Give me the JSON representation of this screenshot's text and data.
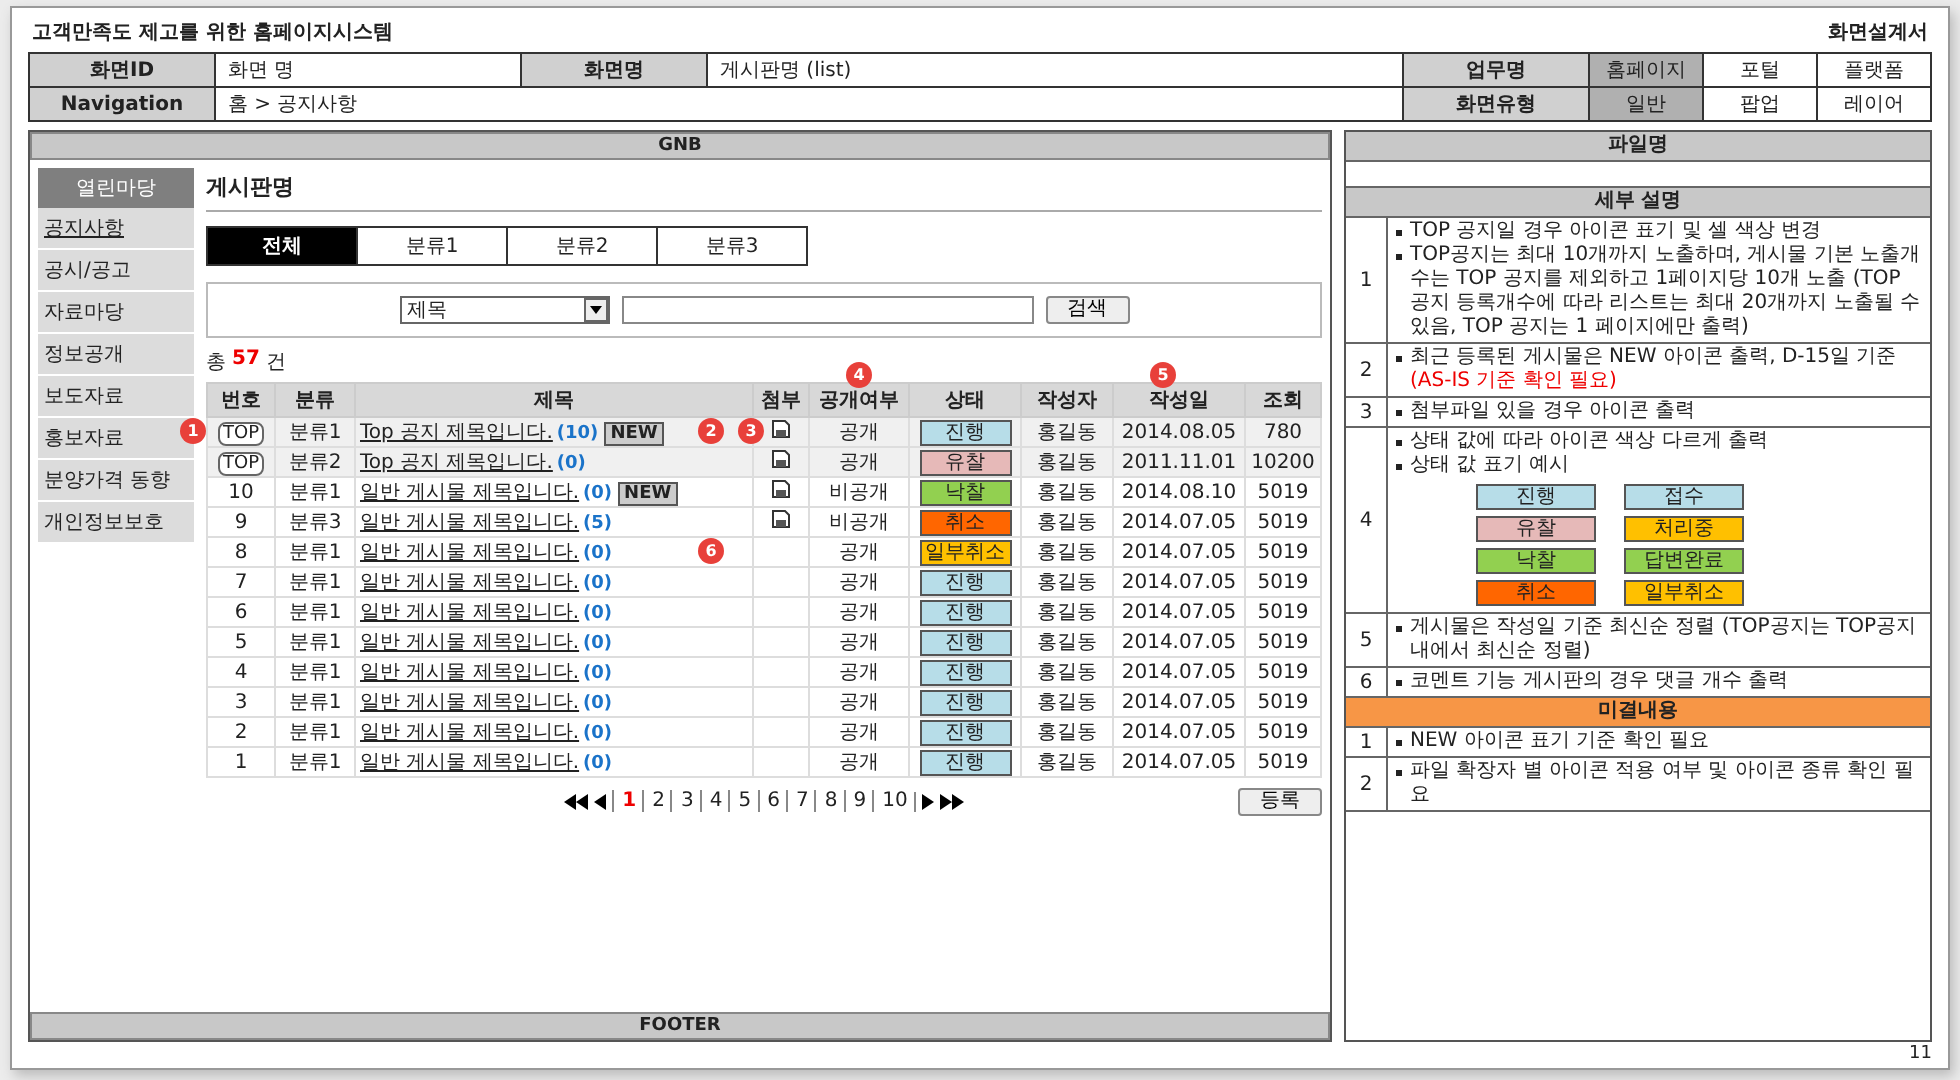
{
  "doc": {
    "project": "고객만족도 제고를 위한 홈페이지시스템",
    "doc_type": "화면설계서",
    "page_number": "11"
  },
  "info": {
    "id_label": "화면ID",
    "id_value": "화면 명",
    "name_label": "화면명",
    "name_value": "게시판명 (list)",
    "nav_label": "Navigation",
    "nav_value": "홈 > 공지사항",
    "work_label": "업무명",
    "type_label": "화면유형",
    "work_options": [
      {
        "label": "홈페이지",
        "selected": true
      },
      {
        "label": "포털",
        "selected": false
      },
      {
        "label": "플랫폼",
        "selected": false
      }
    ],
    "type_options": [
      {
        "label": "일반",
        "selected": true
      },
      {
        "label": "팝업",
        "selected": false
      },
      {
        "label": "레이어",
        "selected": false
      }
    ]
  },
  "gnb": "GNB",
  "footer": "FOOTER",
  "sidebar": {
    "title": "열린마당",
    "items": [
      {
        "label": "공지사항",
        "selected": true
      },
      {
        "label": "공시/공고",
        "selected": false
      },
      {
        "label": "자료마당",
        "selected": false
      },
      {
        "label": "정보공개",
        "selected": false
      },
      {
        "label": "보도자료",
        "selected": false
      },
      {
        "label": "홍보자료",
        "selected": false
      },
      {
        "label": "분양가격 동향",
        "selected": false
      },
      {
        "label": "개인정보보호",
        "selected": false
      }
    ]
  },
  "board": {
    "title": "게시판명",
    "tabs": [
      {
        "label": "전체",
        "selected": true
      },
      {
        "label": "분류1",
        "selected": false
      },
      {
        "label": "분류2",
        "selected": false
      },
      {
        "label": "분류3",
        "selected": false
      }
    ],
    "search": {
      "select_value": "제목",
      "button": "검색"
    },
    "count": {
      "prefix": "총",
      "value": "57",
      "suffix": "건"
    },
    "columns": [
      {
        "label": "번호"
      },
      {
        "label": "분류"
      },
      {
        "label": "제목"
      },
      {
        "label": "첨부"
      },
      {
        "label": "공개여부",
        "marker": "4"
      },
      {
        "label": "상태"
      },
      {
        "label": "작성자"
      },
      {
        "label": "작성일",
        "marker": "5"
      },
      {
        "label": "조회"
      }
    ],
    "rows": [
      {
        "kind": "top",
        "no": "TOP",
        "category": "분류1",
        "title": "Top 공지 제목입니다.",
        "comments": "(10)",
        "new_badge": "NEW",
        "attachment": true,
        "visibility": "공개",
        "status": {
          "label": "진행",
          "color": "#b7dde8"
        },
        "author": "홍길동",
        "date": "2014.08.05",
        "views": "780",
        "no_marker": "1",
        "title_marker": "2",
        "attach_marker": "3"
      },
      {
        "kind": "top",
        "no": "TOP",
        "category": "분류2",
        "title": "Top 공지 제목입니다.",
        "comments": "(0)",
        "attachment": true,
        "visibility": "공개",
        "status": {
          "label": "유찰",
          "color": "#e6b9b8"
        },
        "author": "홍길동",
        "date": "2011.11.01",
        "views": "10200"
      },
      {
        "kind": "normal",
        "no": "10",
        "category": "분류1",
        "title": "일반 게시물 제목입니다.",
        "comments": "(0)",
        "new_badge": "NEW",
        "attachment": true,
        "visibility": "비공개",
        "status": {
          "label": "낙찰",
          "color": "#92d050"
        },
        "author": "홍길동",
        "date": "2014.08.10",
        "views": "5019"
      },
      {
        "kind": "normal",
        "no": "9",
        "category": "분류3",
        "title": "일반 게시물 제목입니다.",
        "comments": "(5)",
        "attachment": true,
        "visibility": "비공개",
        "status": {
          "label": "취소",
          "color": "#ff6600"
        },
        "author": "홍길동",
        "date": "2014.07.05",
        "views": "5019"
      },
      {
        "kind": "normal",
        "no": "8",
        "category": "분류1",
        "title": "일반 게시물 제목입니다.",
        "comments": "(0)",
        "attachment": false,
        "visibility": "공개",
        "status": {
          "label": "일부취소",
          "color": "#ffc000"
        },
        "author": "홍길동",
        "date": "2014.07.05",
        "views": "5019",
        "title_marker": "6"
      },
      {
        "kind": "normal",
        "no": "7",
        "category": "분류1",
        "title": "일반 게시물 제목입니다.",
        "comments": "(0)",
        "attachment": false,
        "visibility": "공개",
        "status": {
          "label": "진행",
          "color": "#b7dde8"
        },
        "author": "홍길동",
        "date": "2014.07.05",
        "views": "5019"
      },
      {
        "kind": "normal",
        "no": "6",
        "category": "분류1",
        "title": "일반 게시물 제목입니다.",
        "comments": "(0)",
        "attachment": false,
        "visibility": "공개",
        "status": {
          "label": "진행",
          "color": "#b7dde8"
        },
        "author": "홍길동",
        "date": "2014.07.05",
        "views": "5019"
      },
      {
        "kind": "normal",
        "no": "5",
        "category": "분류1",
        "title": "일반 게시물 제목입니다.",
        "comments": "(0)",
        "attachment": false,
        "visibility": "공개",
        "status": {
          "label": "진행",
          "color": "#b7dde8"
        },
        "author": "홍길동",
        "date": "2014.07.05",
        "views": "5019"
      },
      {
        "kind": "normal",
        "no": "4",
        "category": "분류1",
        "title": "일반 게시물 제목입니다.",
        "comments": "(0)",
        "attachment": false,
        "visibility": "공개",
        "status": {
          "label": "진행",
          "color": "#b7dde8"
        },
        "author": "홍길동",
        "date": "2014.07.05",
        "views": "5019"
      },
      {
        "kind": "normal",
        "no": "3",
        "category": "분류1",
        "title": "일반 게시물 제목입니다.",
        "comments": "(0)",
        "attachment": false,
        "visibility": "공개",
        "status": {
          "label": "진행",
          "color": "#b7dde8"
        },
        "author": "홍길동",
        "date": "2014.07.05",
        "views": "5019"
      },
      {
        "kind": "normal",
        "no": "2",
        "category": "분류1",
        "title": "일반 게시물 제목입니다.",
        "comments": "(0)",
        "attachment": false,
        "visibility": "공개",
        "status": {
          "label": "진행",
          "color": "#b7dde8"
        },
        "author": "홍길동",
        "date": "2014.07.05",
        "views": "5019"
      },
      {
        "kind": "normal",
        "no": "1",
        "category": "분류1",
        "title": "일반 게시물 제목입니다.",
        "comments": "(0)",
        "attachment": false,
        "visibility": "공개",
        "status": {
          "label": "진행",
          "color": "#b7dde8"
        },
        "author": "홍길동",
        "date": "2014.07.05",
        "views": "5019"
      }
    ],
    "pagination": {
      "pages": [
        {
          "label": "1",
          "selected": true
        },
        {
          "label": "2",
          "selected": false
        },
        {
          "label": "3",
          "selected": false
        },
        {
          "label": "4",
          "selected": false
        },
        {
          "label": "5",
          "selected": false
        },
        {
          "label": "6",
          "selected": false
        },
        {
          "label": "7",
          "selected": false
        },
        {
          "label": "8",
          "selected": false
        },
        {
          "label": "9",
          "selected": false
        },
        {
          "label": "10",
          "selected": false
        }
      ]
    },
    "register_button": "등록"
  },
  "spec": {
    "file_header": "파일명",
    "detail_header": "세부 설명",
    "details": [
      {
        "no": "1",
        "bullets": [
          {
            "text": "TOP 공지일 경우 아이콘 표기 및 셀 색상 변경"
          },
          {
            "text": "TOP공지는 최대 10개까지 노출하며, 게시물 기본 노출개수는 TOP 공지를 제외하고 1페이지당 10개 노출 (TOP 공지 등록개수에 따라 리스트는 최대 20개까지 노출될 수 있음, TOP 공지는 1 페이지에만 출력)"
          }
        ]
      },
      {
        "no": "2",
        "bullets": [
          {
            "text": "최근 등록된 게시물은 NEW 아이콘 출력, D-15일 기준",
            "note": "(AS-IS 기준 확인 필요)"
          }
        ]
      },
      {
        "no": "3",
        "bullets": [
          {
            "text": "첨부파일 있을 경우 아이콘 출력"
          }
        ]
      },
      {
        "no": "4",
        "bullets": [
          {
            "text": "상태 값에 따라 아이콘 색상 다르게 출력"
          },
          {
            "text": "상태 값 표기 예시"
          }
        ],
        "badges": [
          {
            "label": "진행",
            "color": "#b7dde8"
          },
          {
            "label": "접수",
            "color": "#b7dde8"
          },
          {
            "label": "유찰",
            "color": "#e6b9b8"
          },
          {
            "label": "처리중",
            "color": "#ffc000"
          },
          {
            "label": "낙찰",
            "color": "#92d050"
          },
          {
            "label": "답변완료",
            "color": "#92d050"
          },
          {
            "label": "취소",
            "color": "#ff6600"
          },
          {
            "label": "일부취소",
            "color": "#ffc000"
          }
        ]
      },
      {
        "no": "5",
        "bullets": [
          {
            "text": "게시물은 작성일 기준 최신순 정렬 (TOP공지는 TOP공지 내에서 최신순 정렬)"
          }
        ]
      },
      {
        "no": "6",
        "bullets": [
          {
            "text": "코멘트 기능 게시판의 경우 댓글 개수 출력"
          }
        ]
      }
    ],
    "pending_header": "미결내용",
    "pending": [
      {
        "no": "1",
        "bullets": [
          {
            "text": "NEW 아이콘 표기 기준 확인 필요"
          }
        ]
      },
      {
        "no": "2",
        "bullets": [
          {
            "text": "파일 확장자 별 아이콘 적용 여부 및 아이콘 종류 확인 필요"
          }
        ]
      }
    ]
  }
}
